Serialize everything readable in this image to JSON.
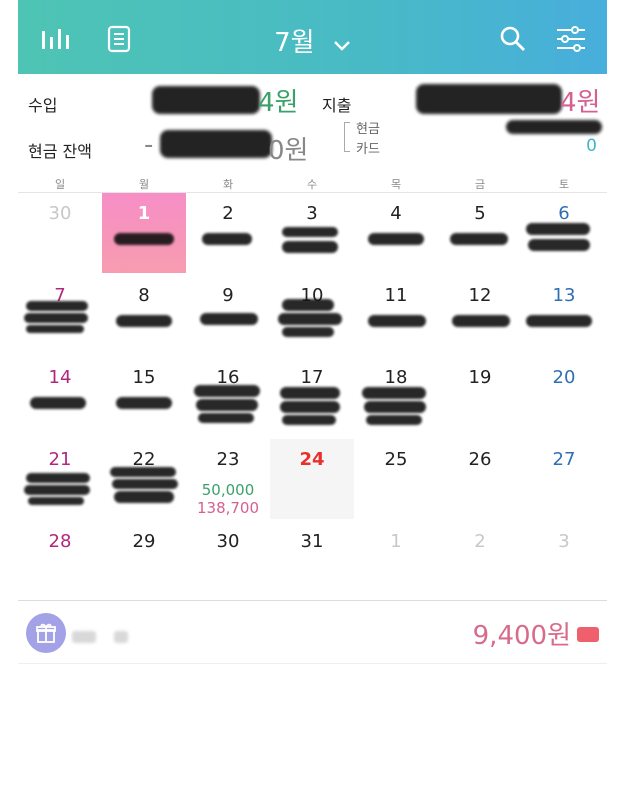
{
  "header": {
    "month_title": "7월",
    "icons": [
      "bar-chart-icon",
      "list-document-icon",
      "chevron-down-icon",
      "search-icon",
      "filter-sliders-icon"
    ]
  },
  "summary": {
    "income_label": "수입",
    "expense_label": "지출",
    "cash_balance_label": "현금 잔액",
    "income_amount_visible": "4원",
    "expense_amount_visible": "4원",
    "balance_amount_visible": "0원",
    "balance_minus": "-",
    "cash_label": "현금",
    "card_label": "카드",
    "card_amount": "0",
    "colors": {
      "income": "#3aa16b",
      "expense": "#d4618f",
      "balance": "#888888",
      "card": "#3cb8c6"
    }
  },
  "weekdays": [
    "일",
    "월",
    "화",
    "수",
    "목",
    "금",
    "토"
  ],
  "calendar": {
    "weeks": [
      [
        {
          "d": "30",
          "t": "grey"
        },
        {
          "d": "1",
          "t": "sel"
        },
        {
          "d": "2",
          "t": "black"
        },
        {
          "d": "3",
          "t": "black"
        },
        {
          "d": "4",
          "t": "black"
        },
        {
          "d": "5",
          "t": "black"
        },
        {
          "d": "6",
          "t": "sat"
        }
      ],
      [
        {
          "d": "7",
          "t": "sun"
        },
        {
          "d": "8",
          "t": "black"
        },
        {
          "d": "9",
          "t": "black"
        },
        {
          "d": "10",
          "t": "black"
        },
        {
          "d": "11",
          "t": "black"
        },
        {
          "d": "12",
          "t": "black"
        },
        {
          "d": "13",
          "t": "sat"
        }
      ],
      [
        {
          "d": "14",
          "t": "sun"
        },
        {
          "d": "15",
          "t": "black"
        },
        {
          "d": "16",
          "t": "black"
        },
        {
          "d": "17",
          "t": "black"
        },
        {
          "d": "18",
          "t": "black"
        },
        {
          "d": "19",
          "t": "black"
        },
        {
          "d": "20",
          "t": "sat"
        }
      ],
      [
        {
          "d": "21",
          "t": "sun"
        },
        {
          "d": "22",
          "t": "black"
        },
        {
          "d": "23",
          "t": "black"
        },
        {
          "d": "24",
          "t": "today"
        },
        {
          "d": "25",
          "t": "black"
        },
        {
          "d": "26",
          "t": "black"
        },
        {
          "d": "27",
          "t": "sat"
        }
      ],
      [
        {
          "d": "28",
          "t": "sun"
        },
        {
          "d": "29",
          "t": "black"
        },
        {
          "d": "30",
          "t": "black"
        },
        {
          "d": "31",
          "t": "black"
        },
        {
          "d": "1",
          "t": "grey"
        },
        {
          "d": "2",
          "t": "grey"
        },
        {
          "d": "3",
          "t": "grey"
        }
      ]
    ],
    "day_23_income": "50,000",
    "day_23_expense": "138,700"
  },
  "bottom": {
    "point_amount": "9,400원",
    "icons": [
      "gift-icon",
      "card-icon"
    ]
  }
}
